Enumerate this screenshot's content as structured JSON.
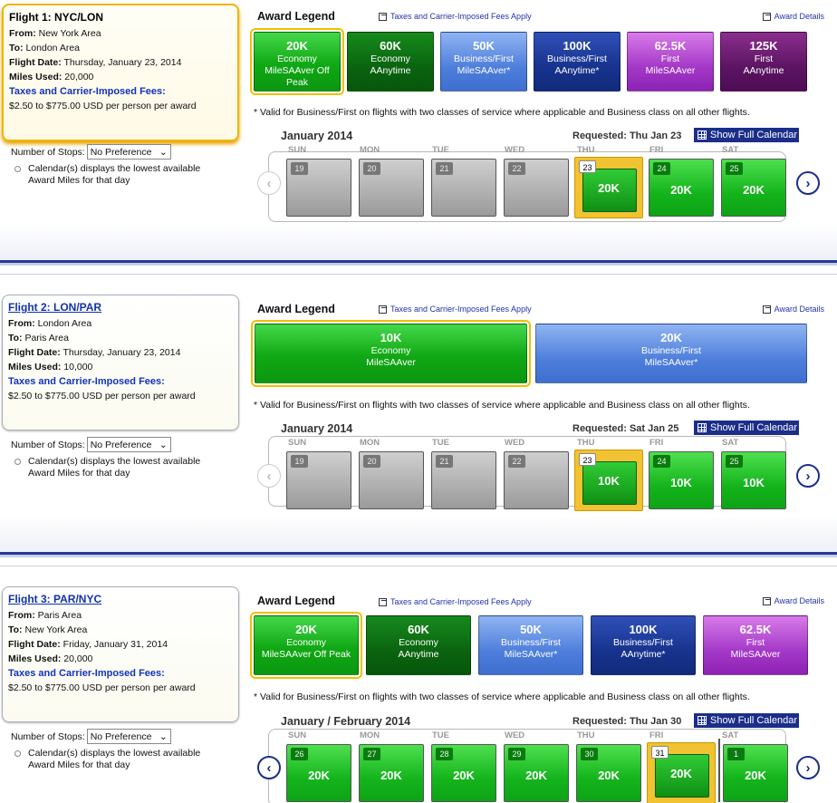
{
  "legend_title": "Award Legend",
  "tax_link": "Taxes and Carrier-Imposed Fees Apply",
  "award_details": "Award Details",
  "note": "* Valid for Business/First on flights with two classes of service where applicable and Business class on all other flights.",
  "show_calendar": "Show Full Calendar",
  "stops_label": "Number of Stops:",
  "stops_value": "No Preference",
  "calendar_note_1": "Calendar(s) displays the lowest available",
  "calendar_note_2": "Award Miles for that day",
  "labels": {
    "from": "From:",
    "to": "To:",
    "date": "Flight Date:",
    "miles": "Miles Used:",
    "taxes": "Taxes and Carrier-Imposed Fees:"
  },
  "price": "$2.50 to $775.00 USD per person per award",
  "colors": {
    "green": "#10a814",
    "dark_green": "#0a6410",
    "light_blue": "#4f7fdc",
    "dark_blue": "#17338e",
    "purple": "#a338c8",
    "dark_purple": "#5c1462",
    "accent_yellow": "#f0c000",
    "nav_blue": "#1b2e8a"
  },
  "flights": [
    {
      "title": "Flight 1: NYC/LON",
      "from": "New York Area",
      "to": "London Area",
      "date": "Thursday, January 23, 2014",
      "miles": "20,000",
      "awards": [
        {
          "value": "20K",
          "l1": "Economy",
          "l2": "MileSAAver Off Peak",
          "color": "green",
          "selected": true
        },
        {
          "value": "60K",
          "l1": "Economy",
          "l2": "AAnytime",
          "color": "dark_green"
        },
        {
          "value": "50K",
          "l1": "Business/First",
          "l2": "MileSAAver*",
          "color": "light_blue"
        },
        {
          "value": "100K",
          "l1": "Business/First",
          "l2": "AAnytime*",
          "color": "dark_blue"
        },
        {
          "value": "62.5K",
          "l1": "First",
          "l2": "MileSAAver",
          "color": "purple"
        },
        {
          "value": "125K",
          "l1": "First",
          "l2": "AAnytime",
          "color": "dark_purple"
        }
      ],
      "month": "January 2014",
      "requested": "Requested: Thu Jan 23",
      "days": [
        {
          "dow": "SUN",
          "num": "19",
          "val": "",
          "state": "gray"
        },
        {
          "dow": "MON",
          "num": "20",
          "val": "",
          "state": "gray"
        },
        {
          "dow": "TUE",
          "num": "21",
          "val": "",
          "state": "gray"
        },
        {
          "dow": "WED",
          "num": "22",
          "val": "",
          "state": "gray"
        },
        {
          "dow": "THU",
          "num": "23",
          "val": "20K",
          "state": "requested"
        },
        {
          "dow": "FRI",
          "num": "24",
          "val": "20K",
          "state": "green"
        },
        {
          "dow": "SAT",
          "num": "25",
          "val": "20K",
          "state": "green"
        }
      ]
    },
    {
      "title": "Flight 2: LON/PAR",
      "from": "London Area",
      "to": "Paris Area",
      "date": "Thursday, January 23, 2014",
      "miles": "10,000",
      "awards": [
        {
          "value": "10K",
          "l1": "Economy",
          "l2": "MileSAAver",
          "color": "green",
          "selected": true
        },
        {
          "value": "20K",
          "l1": "Business/First",
          "l2": "MileSAAver*",
          "color": "light_blue"
        }
      ],
      "month": "January 2014",
      "requested": "Requested: Sat Jan 25",
      "days": [
        {
          "dow": "SUN",
          "num": "19",
          "val": "",
          "state": "gray"
        },
        {
          "dow": "MON",
          "num": "20",
          "val": "",
          "state": "gray"
        },
        {
          "dow": "TUE",
          "num": "21",
          "val": "",
          "state": "gray"
        },
        {
          "dow": "WED",
          "num": "22",
          "val": "",
          "state": "gray"
        },
        {
          "dow": "THU",
          "num": "23",
          "val": "10K",
          "state": "requested"
        },
        {
          "dow": "FRI",
          "num": "24",
          "val": "10K",
          "state": "green"
        },
        {
          "dow": "SAT",
          "num": "25",
          "val": "10K",
          "state": "green"
        }
      ]
    },
    {
      "title": "Flight 3: PAR/NYC",
      "from": "Paris Area",
      "to": "New York Area",
      "date": "Friday, January 31, 2014",
      "miles": "20,000",
      "awards": [
        {
          "value": "20K",
          "l1": "Economy",
          "l2": "MileSAAver Off Peak",
          "color": "green",
          "selected": true
        },
        {
          "value": "60K",
          "l1": "Economy",
          "l2": "AAnytime",
          "color": "dark_green"
        },
        {
          "value": "50K",
          "l1": "Business/First",
          "l2": "MileSAAver*",
          "color": "light_blue"
        },
        {
          "value": "100K",
          "l1": "Business/First",
          "l2": "AAnytime*",
          "color": "dark_blue"
        },
        {
          "value": "62.5K",
          "l1": "First",
          "l2": "MileSAAver",
          "color": "purple"
        }
      ],
      "month": "January / February 2014",
      "requested": "Requested: Thu Jan 30",
      "days": [
        {
          "dow": "SUN",
          "num": "26",
          "val": "20K",
          "state": "green"
        },
        {
          "dow": "MON",
          "num": "27",
          "val": "20K",
          "state": "green"
        },
        {
          "dow": "TUE",
          "num": "28",
          "val": "20K",
          "state": "green"
        },
        {
          "dow": "WED",
          "num": "29",
          "val": "20K",
          "state": "green"
        },
        {
          "dow": "THU",
          "num": "30",
          "val": "20K",
          "state": "green"
        },
        {
          "dow": "FRI",
          "num": "31",
          "val": "20K",
          "state": "requested"
        },
        {
          "dow": "SAT",
          "num": "1",
          "val": "20K",
          "state": "green"
        }
      ]
    }
  ]
}
